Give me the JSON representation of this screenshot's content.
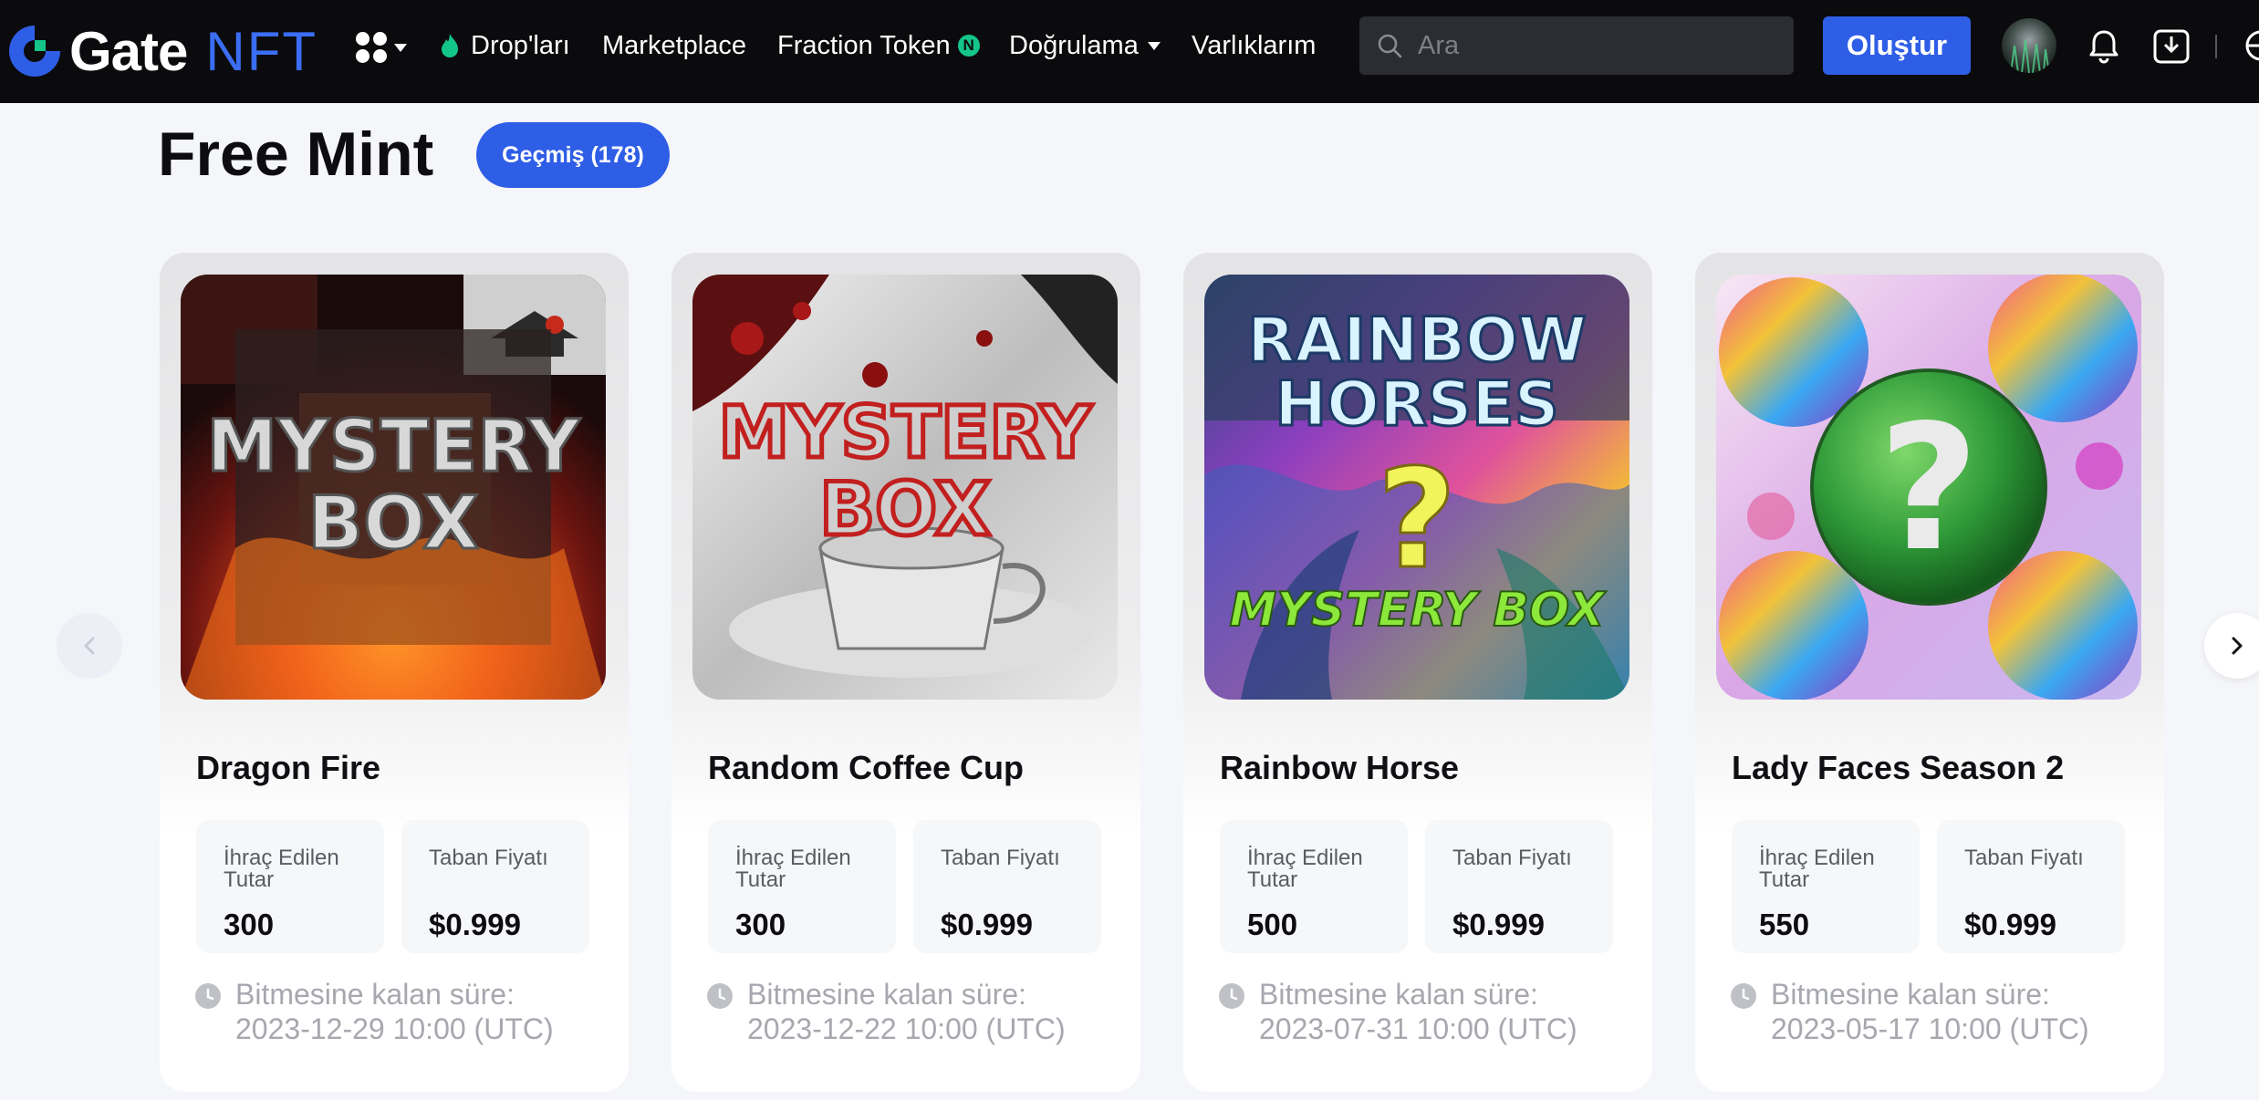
{
  "nav": {
    "logo_text": "Gate",
    "logo_nft": "NFT",
    "drops_label": "Drop'ları",
    "marketplace_label": "Marketplace",
    "fraction_label": "Fraction Token",
    "fraction_badge": "N",
    "verify_label": "Doğrulama",
    "assets_label": "Varlıklarım",
    "search_placeholder": "Ara",
    "create_label": "Oluştur"
  },
  "header": {
    "title": "Free Mint",
    "history_label": "Geçmiş (178)"
  },
  "cards": [
    {
      "name": "Dragon Fire",
      "issued_label": "İhraç Edilen Tutar",
      "issued_value": "300",
      "floor_label": "Taban Fiyatı",
      "floor_value": "$0.999",
      "time_label": "Bitmesine kalan süre:",
      "time_value": "2023-12-29 10:00 (UTC)",
      "image_text_1": "MYSTERY",
      "image_text_2": "BOX"
    },
    {
      "name": "Random Coffee Cup",
      "issued_label": "İhraç Edilen Tutar",
      "issued_value": "300",
      "floor_label": "Taban Fiyatı",
      "floor_value": "$0.999",
      "time_label": "Bitmesine kalan süre:",
      "time_value": "2023-12-22 10:00 (UTC)",
      "image_text_1": "MYSTERY",
      "image_text_2": "BOX"
    },
    {
      "name": "Rainbow Horse",
      "issued_label": "İhraç Edilen Tutar",
      "issued_value": "500",
      "floor_label": "Taban Fiyatı",
      "floor_value": "$0.999",
      "time_label": "Bitmesine kalan süre:",
      "time_value": "2023-07-31 10:00 (UTC)",
      "image_text_1": "RAINBOW",
      "image_text_2": "HORSES",
      "image_text_3": "?",
      "image_text_4": "MYSTERY BOX"
    },
    {
      "name": "Lady Faces Season 2",
      "issued_label": "İhraç Edilen Tutar",
      "issued_value": "550",
      "floor_label": "Taban Fiyatı",
      "floor_value": "$0.999",
      "time_label": "Bitmesine kalan süre:",
      "time_value": "2023-05-17 10:00 (UTC)",
      "image_text_1": "?"
    }
  ],
  "colors": {
    "brand_blue": "#2f5ee6",
    "navbar_bg": "#0b0b0d",
    "accent_green": "#14c58a"
  },
  "icons": [
    "gate-logo-icon",
    "apps-grid-icon",
    "flame-icon",
    "search-icon",
    "bell-icon",
    "download-icon",
    "globe-icon",
    "clock-icon",
    "chevron-left-icon",
    "chevron-right-icon"
  ]
}
